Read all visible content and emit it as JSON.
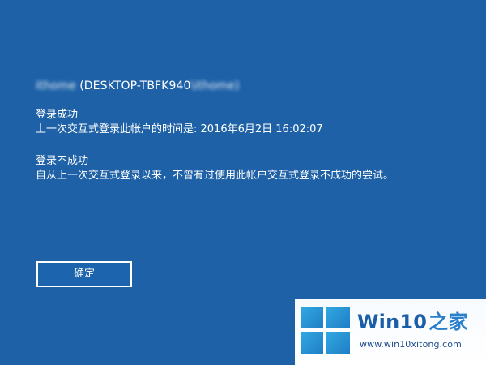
{
  "account": {
    "blurred_name": "ithome",
    "computer": "(DESKTOP-TBFK940",
    "blurred_suffix": "\\ithome)"
  },
  "login_success": {
    "title": "登录成功",
    "detail": "上一次交互式登录此帐户的时间是: 2016年6月2日 16:02:07"
  },
  "login_failure": {
    "title": "登录不成功",
    "detail": "自从上一次交互式登录以来，不曾有过使用此帐户交互式登录不成功的尝试。"
  },
  "button": {
    "ok_label": "确定"
  },
  "watermark": {
    "brand_prefix": "Win10",
    "brand_suffix": "之家",
    "site": "www.win10xitong.com"
  },
  "colors": {
    "background": "#1e61a7",
    "text": "#ffffff",
    "logo_blue": "#2a7fcb"
  },
  "icons": {
    "logo": "windows-logo-icon"
  }
}
